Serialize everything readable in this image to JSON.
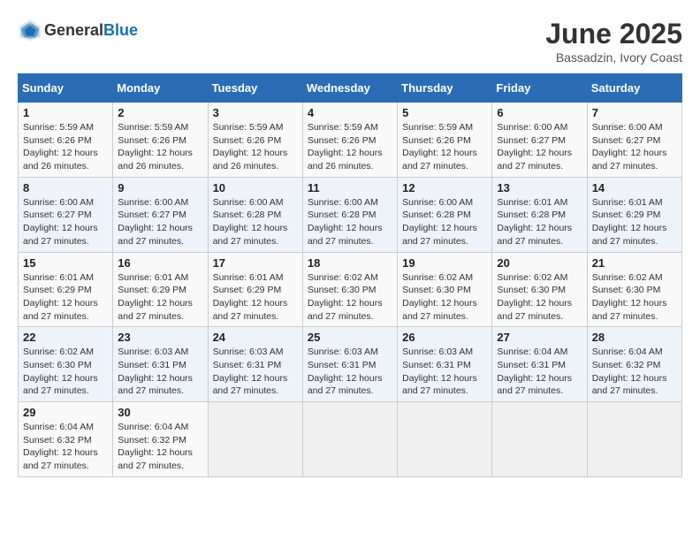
{
  "header": {
    "logo_general": "General",
    "logo_blue": "Blue",
    "title": "June 2025",
    "subtitle": "Bassadzin, Ivory Coast"
  },
  "calendar": {
    "days_of_week": [
      "Sunday",
      "Monday",
      "Tuesday",
      "Wednesday",
      "Thursday",
      "Friday",
      "Saturday"
    ],
    "weeks": [
      [
        {
          "day": "",
          "info": ""
        },
        {
          "day": "2",
          "info": "Sunrise: 5:59 AM\nSunset: 6:26 PM\nDaylight: 12 hours\nand 26 minutes."
        },
        {
          "day": "3",
          "info": "Sunrise: 5:59 AM\nSunset: 6:26 PM\nDaylight: 12 hours\nand 26 minutes."
        },
        {
          "day": "4",
          "info": "Sunrise: 5:59 AM\nSunset: 6:26 PM\nDaylight: 12 hours\nand 26 minutes."
        },
        {
          "day": "5",
          "info": "Sunrise: 5:59 AM\nSunset: 6:26 PM\nDaylight: 12 hours\nand 27 minutes."
        },
        {
          "day": "6",
          "info": "Sunrise: 6:00 AM\nSunset: 6:27 PM\nDaylight: 12 hours\nand 27 minutes."
        },
        {
          "day": "7",
          "info": "Sunrise: 6:00 AM\nSunset: 6:27 PM\nDaylight: 12 hours\nand 27 minutes."
        }
      ],
      [
        {
          "day": "1",
          "info": "Sunrise: 5:59 AM\nSunset: 6:26 PM\nDaylight: 12 hours\nand 26 minutes."
        },
        {
          "day": "9",
          "info": "Sunrise: 6:00 AM\nSunset: 6:27 PM\nDaylight: 12 hours\nand 27 minutes."
        },
        {
          "day": "10",
          "info": "Sunrise: 6:00 AM\nSunset: 6:28 PM\nDaylight: 12 hours\nand 27 minutes."
        },
        {
          "day": "11",
          "info": "Sunrise: 6:00 AM\nSunset: 6:28 PM\nDaylight: 12 hours\nand 27 minutes."
        },
        {
          "day": "12",
          "info": "Sunrise: 6:00 AM\nSunset: 6:28 PM\nDaylight: 12 hours\nand 27 minutes."
        },
        {
          "day": "13",
          "info": "Sunrise: 6:01 AM\nSunset: 6:28 PM\nDaylight: 12 hours\nand 27 minutes."
        },
        {
          "day": "14",
          "info": "Sunrise: 6:01 AM\nSunset: 6:29 PM\nDaylight: 12 hours\nand 27 minutes."
        }
      ],
      [
        {
          "day": "8",
          "info": "Sunrise: 6:00 AM\nSunset: 6:27 PM\nDaylight: 12 hours\nand 27 minutes."
        },
        {
          "day": "16",
          "info": "Sunrise: 6:01 AM\nSunset: 6:29 PM\nDaylight: 12 hours\nand 27 minutes."
        },
        {
          "day": "17",
          "info": "Sunrise: 6:01 AM\nSunset: 6:29 PM\nDaylight: 12 hours\nand 27 minutes."
        },
        {
          "day": "18",
          "info": "Sunrise: 6:02 AM\nSunset: 6:30 PM\nDaylight: 12 hours\nand 27 minutes."
        },
        {
          "day": "19",
          "info": "Sunrise: 6:02 AM\nSunset: 6:30 PM\nDaylight: 12 hours\nand 27 minutes."
        },
        {
          "day": "20",
          "info": "Sunrise: 6:02 AM\nSunset: 6:30 PM\nDaylight: 12 hours\nand 27 minutes."
        },
        {
          "day": "21",
          "info": "Sunrise: 6:02 AM\nSunset: 6:30 PM\nDaylight: 12 hours\nand 27 minutes."
        }
      ],
      [
        {
          "day": "15",
          "info": "Sunrise: 6:01 AM\nSunset: 6:29 PM\nDaylight: 12 hours\nand 27 minutes."
        },
        {
          "day": "23",
          "info": "Sunrise: 6:03 AM\nSunset: 6:31 PM\nDaylight: 12 hours\nand 27 minutes."
        },
        {
          "day": "24",
          "info": "Sunrise: 6:03 AM\nSunset: 6:31 PM\nDaylight: 12 hours\nand 27 minutes."
        },
        {
          "day": "25",
          "info": "Sunrise: 6:03 AM\nSunset: 6:31 PM\nDaylight: 12 hours\nand 27 minutes."
        },
        {
          "day": "26",
          "info": "Sunrise: 6:03 AM\nSunset: 6:31 PM\nDaylight: 12 hours\nand 27 minutes."
        },
        {
          "day": "27",
          "info": "Sunrise: 6:04 AM\nSunset: 6:31 PM\nDaylight: 12 hours\nand 27 minutes."
        },
        {
          "day": "28",
          "info": "Sunrise: 6:04 AM\nSunset: 6:32 PM\nDaylight: 12 hours\nand 27 minutes."
        }
      ],
      [
        {
          "day": "22",
          "info": "Sunrise: 6:02 AM\nSunset: 6:30 PM\nDaylight: 12 hours\nand 27 minutes."
        },
        {
          "day": "30",
          "info": "Sunrise: 6:04 AM\nSunset: 6:32 PM\nDaylight: 12 hours\nand 27 minutes."
        },
        {
          "day": "",
          "info": ""
        },
        {
          "day": "",
          "info": ""
        },
        {
          "day": "",
          "info": ""
        },
        {
          "day": "",
          "info": ""
        },
        {
          "day": ""
        }
      ],
      [
        {
          "day": "29",
          "info": "Sunrise: 6:04 AM\nSunset: 6:32 PM\nDaylight: 12 hours\nand 27 minutes."
        },
        {
          "day": "",
          "info": ""
        },
        {
          "day": "",
          "info": ""
        },
        {
          "day": "",
          "info": ""
        },
        {
          "day": "",
          "info": ""
        },
        {
          "day": "",
          "info": ""
        },
        {
          "day": ""
        }
      ]
    ]
  }
}
